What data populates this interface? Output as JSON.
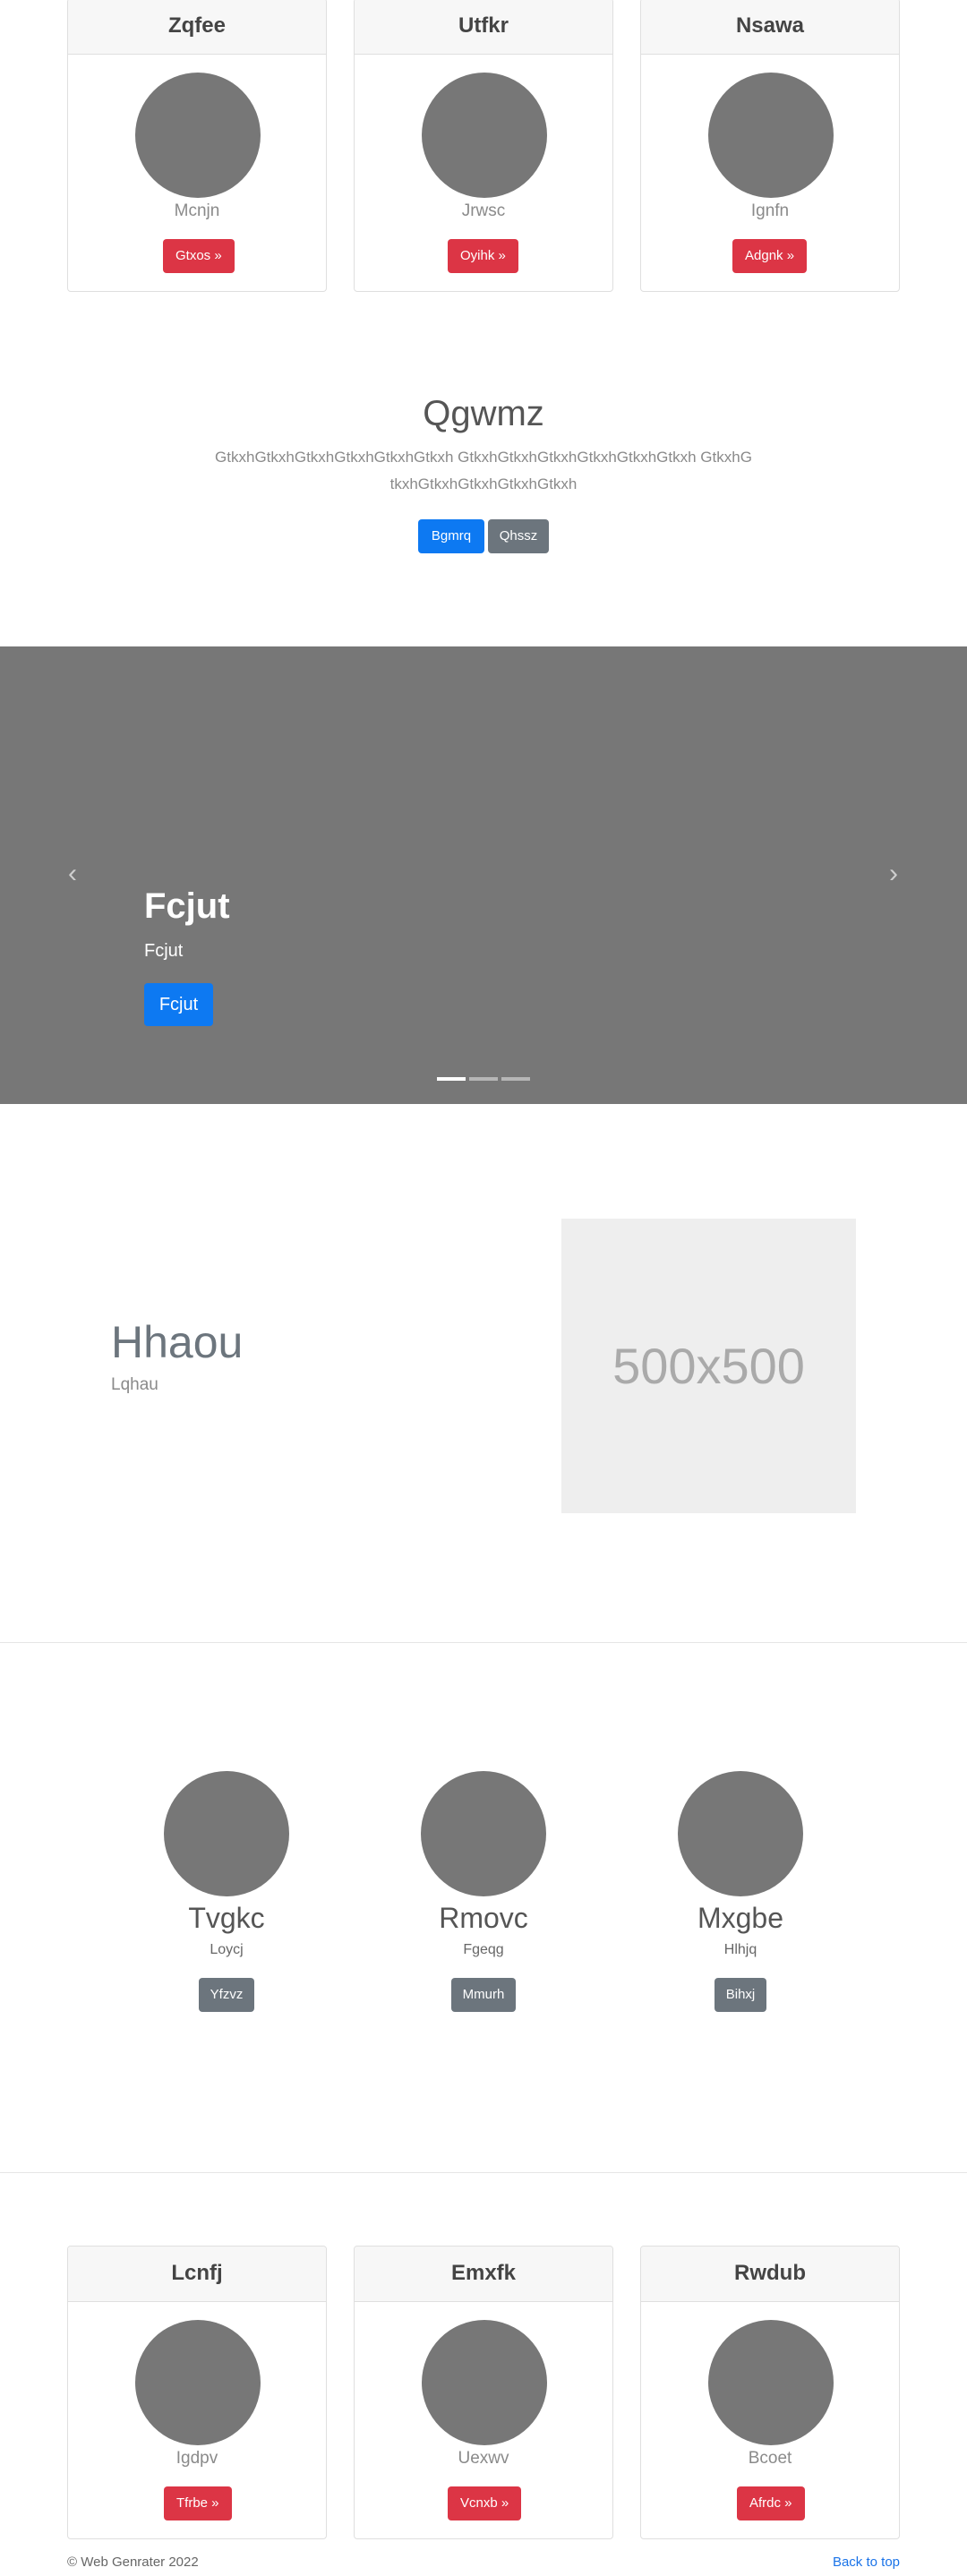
{
  "top_cards": [
    {
      "title": "Zqfee",
      "subtitle": "Mcnjn",
      "button": "Gtxos »"
    },
    {
      "title": "Utfkr",
      "subtitle": "Jrwsc",
      "button": "Oyihk »"
    },
    {
      "title": "Nsawa",
      "subtitle": "Ignfn",
      "button": "Adgnk »"
    }
  ],
  "jumbotron": {
    "title": "Qgwmz",
    "text": "GtkxhGtkxhGtkxhGtkxhGtkxhGtkxh GtkxhGtkxhGtkxhGtkxhGtkxhGtkxh GtkxhGtkxhGtkxhGtkxhGtkxhGtkxh",
    "primary_button": "Bgmrq",
    "secondary_button": "Qhssz"
  },
  "carousel": {
    "title": "Fcjut",
    "subtitle": "Fcjut",
    "button": "Fcjut",
    "prev_icon": "‹",
    "next_icon": "›",
    "active_slide": 1,
    "slide_count": 3
  },
  "feature": {
    "title": "Hhaou",
    "subtitle": "Lqhau",
    "placeholder": "500x500"
  },
  "team": [
    {
      "name": "Tvgkc",
      "role": "Loycj",
      "button": "Yfzvz"
    },
    {
      "name": "Rmovc",
      "role": "Fgeqg",
      "button": "Mmurh"
    },
    {
      "name": "Mxgbe",
      "role": "Hlhjq",
      "button": "Bihxj"
    }
  ],
  "bottom_cards": [
    {
      "title": "Lcnfj",
      "subtitle": "Igdpv",
      "button": "Tfrbe »"
    },
    {
      "title": "Emxfk",
      "subtitle": "Uexwv",
      "button": "Vcnxb »"
    },
    {
      "title": "Rwdub",
      "subtitle": "Bcoet",
      "button": "Afrdc »"
    }
  ],
  "footer": {
    "copyright": "© Web Genrater 2022",
    "back_to_top": "Back to top"
  },
  "colors": {
    "primary": "#0d79f2",
    "danger": "#dc3545",
    "secondary": "#6c757d",
    "placeholder_gray": "#777777"
  }
}
